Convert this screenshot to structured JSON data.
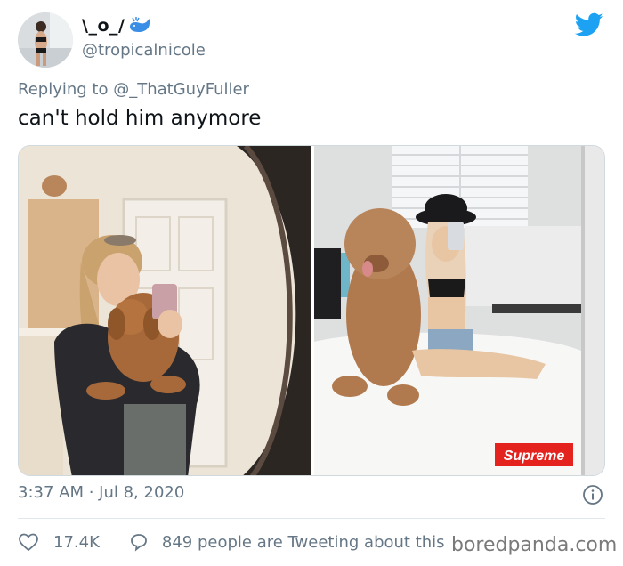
{
  "author": {
    "display_name": "\\_o_/",
    "handle": "@tropicalnicole",
    "avatar_icon": "avatar-photo",
    "emoji_icon": "whale-icon"
  },
  "platform_icon": "twitter-bird-icon",
  "reply_context": {
    "prefix": "Replying to ",
    "mention": "@_ThatGuyFuller"
  },
  "tweet": {
    "text": "can't hold him anymore",
    "timestamp": "3:37 AM · Jul 8, 2020"
  },
  "media": {
    "photo_right_label": "Supreme"
  },
  "stats": {
    "likes": "17.4K",
    "tweeting": "849 people are Tweeting about this"
  },
  "watermark": "boredpanda.com",
  "colors": {
    "twitter_blue": "#1da1f2",
    "muted_text": "#657786",
    "supreme_red": "#e4231f"
  }
}
